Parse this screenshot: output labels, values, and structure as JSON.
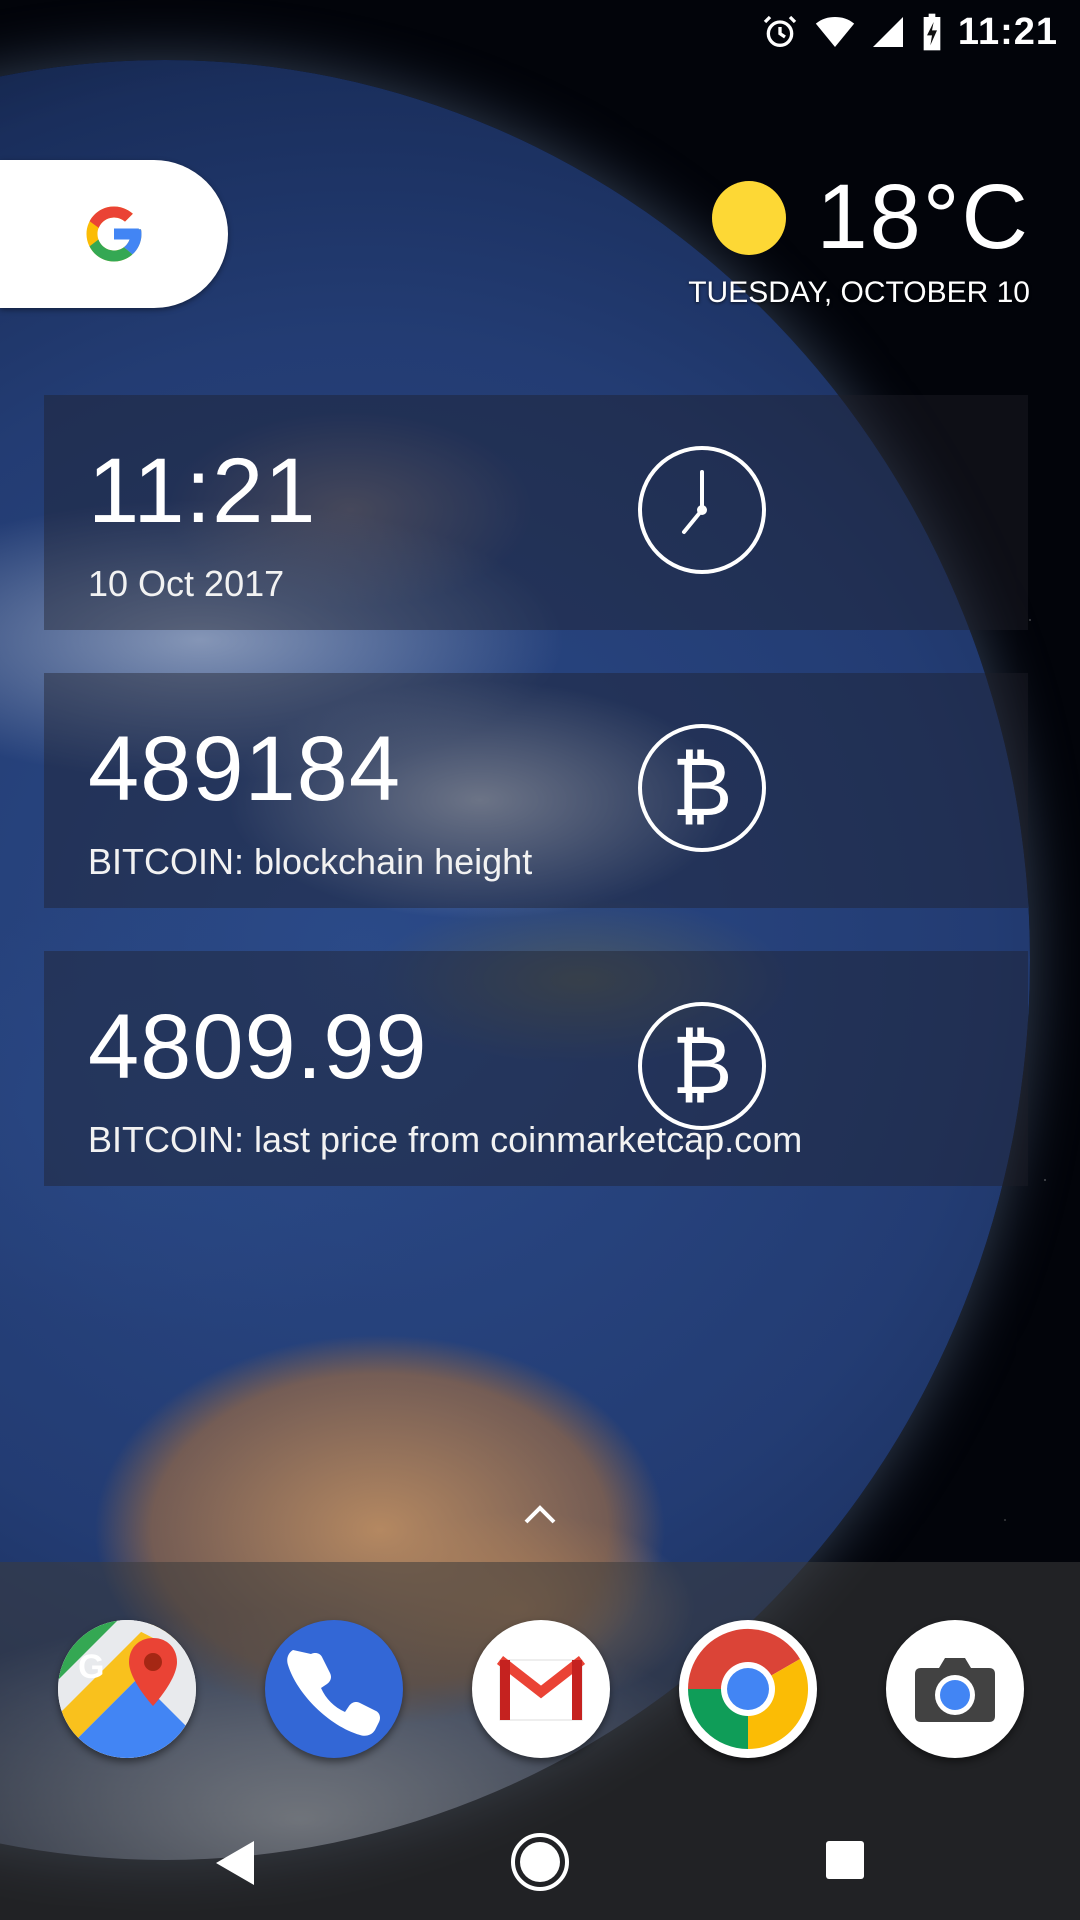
{
  "status_bar": {
    "time": "11:21",
    "icons": [
      "alarm-icon",
      "wifi-icon",
      "cell-signal-icon",
      "battery-charging-icon"
    ]
  },
  "search": {
    "icon": "google-g-icon"
  },
  "weather": {
    "temperature": "18°C",
    "date": "TUESDAY, OCTOBER 10",
    "icon": "sun-icon",
    "sun_color": "#fdd835"
  },
  "widgets": [
    {
      "value": "11:21",
      "label": "10 Oct 2017",
      "icon": "clock-icon"
    },
    {
      "value": "489184",
      "label": "BITCOIN: blockchain height",
      "icon": "bitcoin-icon"
    },
    {
      "value": "4809.99",
      "label": "BITCOIN: last price from coinmarketcap.com",
      "icon": "bitcoin-icon"
    }
  ],
  "bitcoin_glyph": "₿",
  "dock": {
    "apps": [
      "Maps",
      "Phone",
      "Gmail",
      "Chrome",
      "Camera"
    ]
  },
  "colors": {
    "google_blue": "#4285f4",
    "google_red": "#ea4335",
    "google_yellow": "#fbbc05",
    "google_green": "#34a853",
    "phone_blue": "#3367d6"
  }
}
